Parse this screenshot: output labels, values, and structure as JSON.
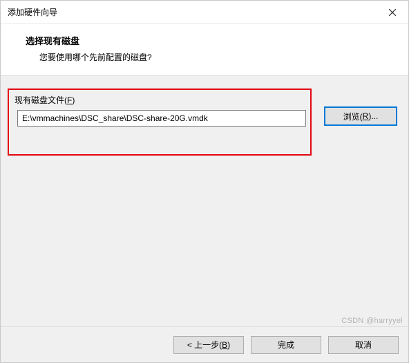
{
  "window": {
    "title": "添加硬件向导"
  },
  "header": {
    "title": "选择现有磁盘",
    "subtitle": "您要使用哪个先前配置的磁盘?"
  },
  "section": {
    "label_prefix": "现有磁盘文件(",
    "label_shortcut": "F",
    "label_suffix": ")",
    "path_value": "E:\\vmmachines\\DSC_share\\DSC-share-20G.vmdk"
  },
  "browse": {
    "label_prefix": "浏览(",
    "label_shortcut": "R",
    "label_suffix": ")..."
  },
  "footer": {
    "back_prefix": "< 上一步(",
    "back_shortcut": "B",
    "back_suffix": ")",
    "finish": "完成",
    "cancel": "取消"
  },
  "watermark": "CSDN @harryyel"
}
